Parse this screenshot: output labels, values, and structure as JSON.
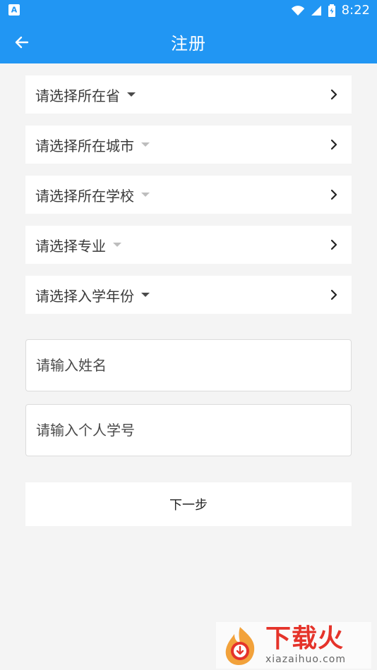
{
  "status_bar": {
    "left_icon_text": "A",
    "time": "8:22",
    "icons": [
      "wifi-icon",
      "signal-icon",
      "battery-icon"
    ]
  },
  "app_bar": {
    "title": "注册",
    "back_icon": "arrow-left-icon"
  },
  "selects": [
    {
      "label": "请选择所在省",
      "caret_state": "active"
    },
    {
      "label": "请选择所在城市",
      "caret_state": "muted"
    },
    {
      "label": "请选择所在学校",
      "caret_state": "muted"
    },
    {
      "label": "请选择专业",
      "caret_state": "muted"
    },
    {
      "label": "请选择入学年份",
      "caret_state": "active"
    }
  ],
  "inputs": {
    "name": {
      "value": "",
      "placeholder": "请输入姓名"
    },
    "student_id": {
      "value": "",
      "placeholder": "请输入个人学号"
    }
  },
  "next_button": {
    "label": "下一步"
  },
  "watermark": {
    "title": "下载火",
    "subtitle": "xiazaihuo.com"
  },
  "colors": {
    "primary": "#2196f3",
    "background": "#f4f4f4",
    "watermark_red": "#e5332a"
  }
}
